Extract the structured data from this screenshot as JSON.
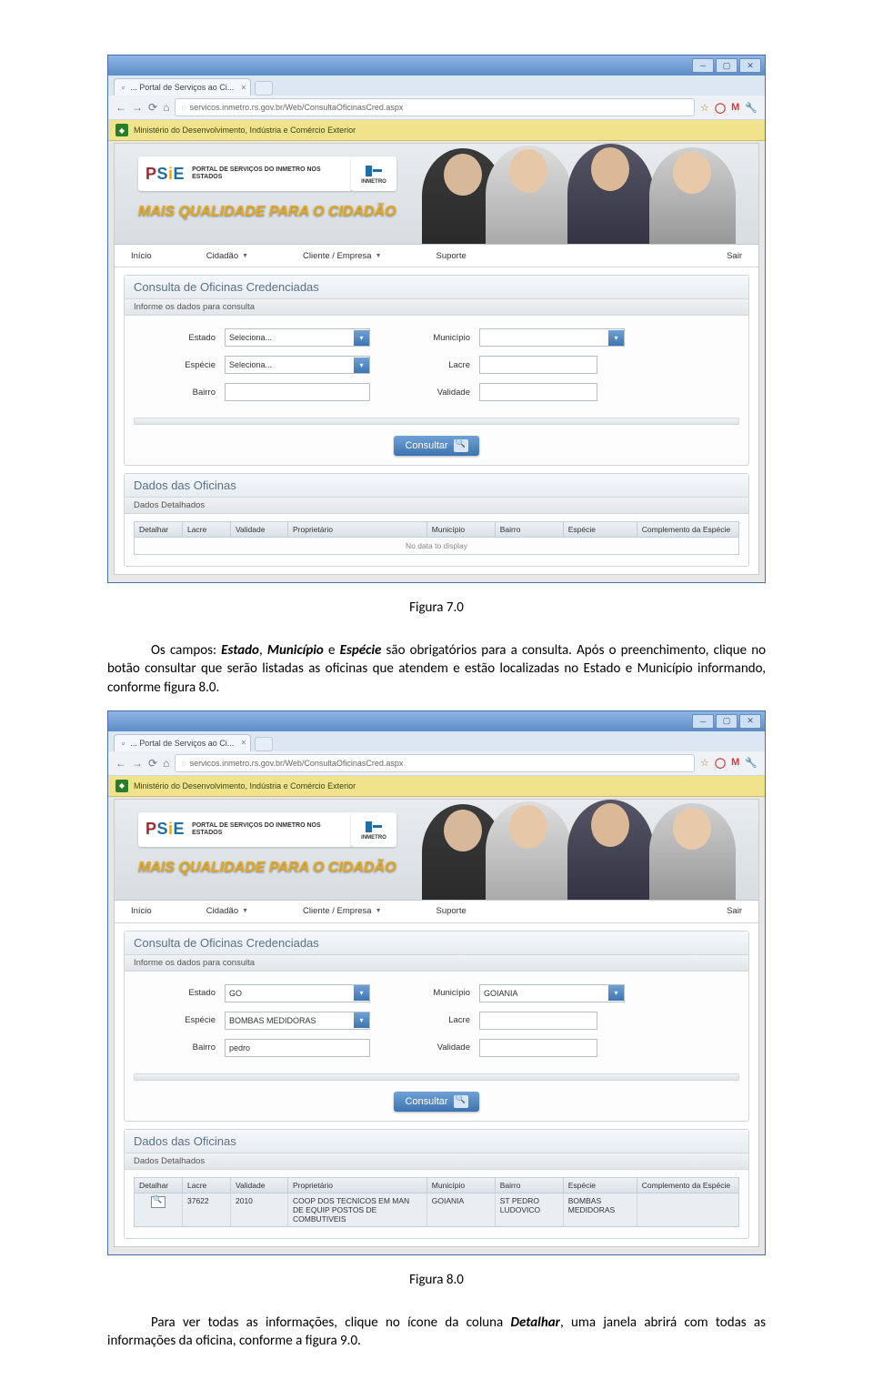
{
  "browser": {
    "tab_title": "... Portal de Serviços ao Ci...",
    "url": "servicos.inmetro.rs.gov.br/Web/ConsultaOficinasCred.aspx",
    "bookmark": "Ministério do Desenvolvimento, Indústria e Comércio Exterior"
  },
  "banner": {
    "logo_sub": "PORTAL DE SERVIÇOS DO INMETRO NOS ESTADOS",
    "slogan": "MAIS QUALIDADE PARA O CIDADÃO",
    "inmetro": "INMETRO"
  },
  "menu": [
    "Início",
    "Cidadão",
    "Cliente / Empresa",
    "Suporte",
    "Sair"
  ],
  "panel": {
    "title": "Consulta de Oficinas Credenciadas",
    "sub": "Informe os dados para consulta",
    "labels": {
      "estado": "Estado",
      "municipio": "Município",
      "especie": "Espécie",
      "lacre": "Lacre",
      "bairro": "Bairro",
      "validade": "Validade"
    },
    "placeholder": "Seleciona...",
    "btn": "Consultar"
  },
  "dados": {
    "title": "Dados das Oficinas",
    "sub": "Dados Detalhados",
    "headers": [
      "Detalhar",
      "Lacre",
      "Validade",
      "Proprietário",
      "Município",
      "Bairro",
      "Espécie",
      "Complemento da Espécie"
    ],
    "nodata": "No data to display"
  },
  "shot1_values": {
    "estado": "Seleciona...",
    "municipio": "",
    "especie": "Seleciona...",
    "lacre": "",
    "bairro": "",
    "validade": ""
  },
  "shot2_values": {
    "estado": "GO",
    "municipio": "GOIANIA",
    "especie": "BOMBAS MEDIDORAS",
    "lacre": "",
    "bairro": "pedro",
    "validade": ""
  },
  "shot2_row": {
    "lacre": "37622",
    "validade": "2010",
    "prop": "COOP DOS TECNICOS EM MAN DE EQUIP POSTOS DE COMBUTIVEIS",
    "mun": "GOIANIA",
    "bairro": "ST PEDRO LUDOVICO",
    "esp": "BOMBAS MEDIDORAS",
    "comp": ""
  },
  "doc": {
    "fig7": "Figura 7.0",
    "para1a": "Os campos: ",
    "para1b": "Estado",
    "para1c": ", ",
    "para1d": "Município",
    "para1e": " e ",
    "para1f": "Espécie",
    "para1g": " são obrigatórios para a consulta. Após o preenchimento, clique no botão consultar que serão listadas as oficinas que atendem e estão localizadas no Estado e Município informando, conforme figura 8.0.",
    "fig8": "Figura 8.0",
    "para2a": "Para ver todas as informações, clique no ícone da coluna ",
    "para2b": "Detalhar",
    "para2c": ", uma janela abrirá com todas as informações da oficina, conforme a figura 9.0."
  }
}
